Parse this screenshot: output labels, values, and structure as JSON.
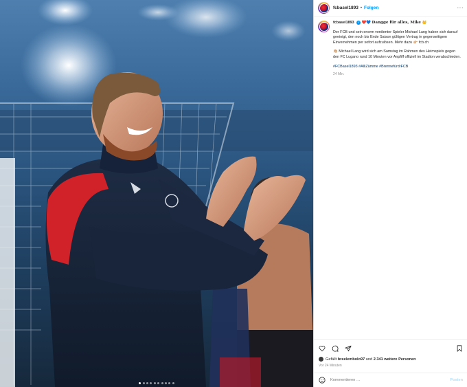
{
  "post": {
    "username": "fcbasel1893",
    "verified_mark": "✓",
    "separator": "•",
    "follow_label": "Folgen",
    "more_label": "···"
  },
  "caption": {
    "username": "fcbasel1893",
    "headline": "Dangge für alles, Mike",
    "headline_emojis": "❤️💙",
    "headline_trailing_emoji": "👑",
    "paragraph1": "Der FCB und sein enorm verdienter Spieler Michael Lang haben sich darauf geeinigt, den noch bis Ende Saison gültigen Vertrag in gegenseitigem Einvernehmen per sofort aufzulösen. Mehr dazu 👉🏼 fcb.ch",
    "paragraph2": "👏🏼 Michael Lang wird sich am Samstag im Rahmen des Heimspiels gegen den FC Lugano rund 10 Minuten vor Anpfiff offiziell im Stadion verabschieden.",
    "hashtags": "#FCBasel1893 #AlliZämme #BrennefürdrFCB",
    "time": "24 Min."
  },
  "actions": {
    "icons": [
      "heart-icon",
      "comment-icon",
      "share-icon",
      "bookmark-icon"
    ]
  },
  "likes": {
    "prefix": "Gefällt",
    "user": "breelembolo97",
    "connector": "und",
    "others": "2.341 weitere Personen"
  },
  "time_ago": "Vor 24 Minuten",
  "comment": {
    "placeholder": "Kommentieren …",
    "post_label": "Posten"
  },
  "carousel": {
    "count": 10,
    "active_index": 0
  },
  "colors": {
    "accent": "#0095f6",
    "hashtag": "#00376b",
    "muted": "#8e8e8e",
    "border": "#dbdbdb"
  }
}
